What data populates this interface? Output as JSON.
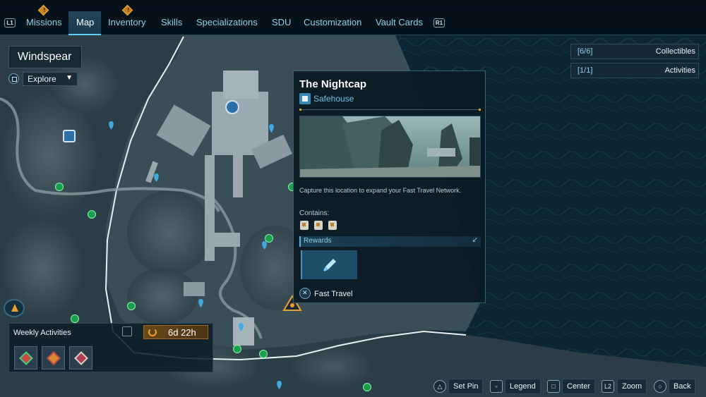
{
  "nav": {
    "left_button": "L1",
    "right_button": "R1",
    "tabs": [
      {
        "label": "Missions",
        "alert": true
      },
      {
        "label": "Map",
        "active": true
      },
      {
        "label": "Inventory",
        "alert": true
      },
      {
        "label": "Skills"
      },
      {
        "label": "Specializations"
      },
      {
        "label": "SDU"
      },
      {
        "label": "Customization"
      },
      {
        "label": "Vault Cards"
      }
    ],
    "alert_glyph": "!"
  },
  "location": {
    "name": "Windspear",
    "filter_value": "Explore"
  },
  "counters": [
    {
      "count": "[6/6]",
      "label": "Collectibles"
    },
    {
      "count": "[1/1]",
      "label": "Activities"
    }
  ],
  "panel": {
    "title": "The Nightcap",
    "type": "Safehouse",
    "type_icon": "safehouse-icon",
    "description": "Capture this location to expand your Fast Travel Network.",
    "contains_label": "Contains:",
    "contains_icons": [
      "collectible-icon",
      "collectible-icon",
      "collectible-icon"
    ],
    "rewards_label": "Rewards",
    "reward_icon": "paint-brush-icon",
    "action_button": "✕",
    "action_label": "Fast Travel"
  },
  "weekly": {
    "title": "Weekly Activities",
    "timer": "6d 22h",
    "colors": {
      "accent": "#c9821c"
    },
    "activities": [
      "weekly-activity-1-icon",
      "weekly-activity-2-icon",
      "weekly-activity-3-icon"
    ]
  },
  "hints": [
    {
      "button": "△",
      "label": "Set Pin"
    },
    {
      "button": "▫",
      "label": "Legend"
    },
    {
      "button": "□",
      "label": "Center"
    },
    {
      "button": "L2",
      "label": "Zoom"
    },
    {
      "button": "○",
      "label": "Back"
    }
  ]
}
